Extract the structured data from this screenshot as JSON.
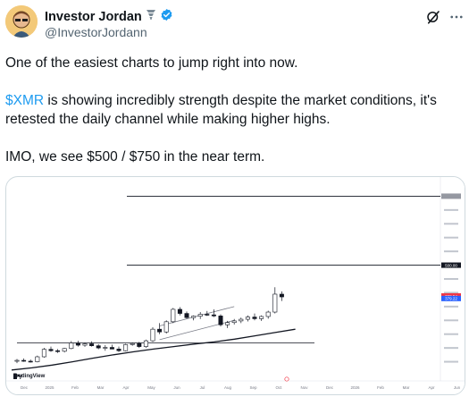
{
  "author": {
    "name": "Investor Jordan",
    "handle": "@InvestorJordann"
  },
  "tweet": {
    "line1": "One of the easiest charts to jump right into now.",
    "cashtag": "$XMR",
    "line2_rest": " is showing incredibly strength despite the market conditions, it's retested the daily channel while making higher highs.",
    "line3": "IMO, we see $500 / $750 in the near term."
  },
  "chart_data": {
    "type": "candlestick",
    "brand": "TradingView",
    "x_tick_labels": [
      "Dec",
      "2025",
      "Feb",
      "Mar",
      "Apr",
      "May",
      "Jun",
      "Jul",
      "Aug",
      "Sep",
      "Oct",
      "Nov",
      "Dec",
      "2026",
      "Feb",
      "Mar",
      "Apr",
      "Jun"
    ],
    "candles": [
      {
        "o": 152,
        "h": 160,
        "l": 145,
        "c": 155
      },
      {
        "o": 155,
        "h": 162,
        "l": 150,
        "c": 152
      },
      {
        "o": 152,
        "h": 158,
        "l": 147,
        "c": 150
      },
      {
        "o": 150,
        "h": 172,
        "l": 148,
        "c": 168
      },
      {
        "o": 168,
        "h": 200,
        "l": 165,
        "c": 195
      },
      {
        "o": 195,
        "h": 205,
        "l": 186,
        "c": 190
      },
      {
        "o": 190,
        "h": 196,
        "l": 182,
        "c": 188
      },
      {
        "o": 188,
        "h": 200,
        "l": 184,
        "c": 198
      },
      {
        "o": 198,
        "h": 225,
        "l": 195,
        "c": 218
      },
      {
        "o": 218,
        "h": 226,
        "l": 205,
        "c": 210
      },
      {
        "o": 210,
        "h": 220,
        "l": 204,
        "c": 215
      },
      {
        "o": 215,
        "h": 224,
        "l": 205,
        "c": 208
      },
      {
        "o": 208,
        "h": 214,
        "l": 195,
        "c": 200
      },
      {
        "o": 200,
        "h": 210,
        "l": 190,
        "c": 202
      },
      {
        "o": 202,
        "h": 212,
        "l": 195,
        "c": 196
      },
      {
        "o": 196,
        "h": 205,
        "l": 185,
        "c": 190
      },
      {
        "o": 190,
        "h": 215,
        "l": 188,
        "c": 212
      },
      {
        "o": 212,
        "h": 220,
        "l": 208,
        "c": 216
      },
      {
        "o": 216,
        "h": 222,
        "l": 200,
        "c": 205
      },
      {
        "o": 205,
        "h": 230,
        "l": 200,
        "c": 226
      },
      {
        "o": 226,
        "h": 275,
        "l": 222,
        "c": 268
      },
      {
        "o": 268,
        "h": 290,
        "l": 250,
        "c": 258
      },
      {
        "o": 258,
        "h": 300,
        "l": 252,
        "c": 295
      },
      {
        "o": 295,
        "h": 345,
        "l": 290,
        "c": 340
      },
      {
        "o": 340,
        "h": 348,
        "l": 318,
        "c": 325
      },
      {
        "o": 325,
        "h": 332,
        "l": 306,
        "c": 310
      },
      {
        "o": 310,
        "h": 318,
        "l": 300,
        "c": 315
      },
      {
        "o": 315,
        "h": 330,
        "l": 305,
        "c": 322
      },
      {
        "o": 322,
        "h": 334,
        "l": 316,
        "c": 320
      },
      {
        "o": 320,
        "h": 340,
        "l": 312,
        "c": 316
      },
      {
        "o": 316,
        "h": 322,
        "l": 278,
        "c": 284
      },
      {
        "o": 284,
        "h": 298,
        "l": 272,
        "c": 292
      },
      {
        "o": 292,
        "h": 305,
        "l": 285,
        "c": 298
      },
      {
        "o": 298,
        "h": 310,
        "l": 290,
        "c": 304
      },
      {
        "o": 304,
        "h": 318,
        "l": 296,
        "c": 312
      },
      {
        "o": 312,
        "h": 325,
        "l": 300,
        "c": 306
      },
      {
        "o": 306,
        "h": 318,
        "l": 298,
        "c": 314
      },
      {
        "o": 314,
        "h": 335,
        "l": 306,
        "c": 330
      },
      {
        "o": 330,
        "h": 420,
        "l": 325,
        "c": 395
      },
      {
        "o": 395,
        "h": 405,
        "l": 370,
        "c": 385
      }
    ],
    "horizontal_levels": [
      750,
      500,
      218
    ],
    "moving_average": [
      120,
      128,
      138,
      150,
      163,
      175,
      186,
      196,
      205,
      214,
      222,
      232,
      244,
      256,
      268
    ],
    "channel_upper": [
      [
        21,
        280
      ],
      [
        32,
        350
      ]
    ],
    "channel_lower": [
      [
        21,
        230
      ],
      [
        32,
        300
      ]
    ],
    "y_range": [
      100,
      800
    ],
    "price_markers": [
      "500.00",
      "388.54",
      "379.22"
    ],
    "colors": {
      "up": "#ffffff",
      "down": "#131722",
      "line": "#131722"
    }
  }
}
